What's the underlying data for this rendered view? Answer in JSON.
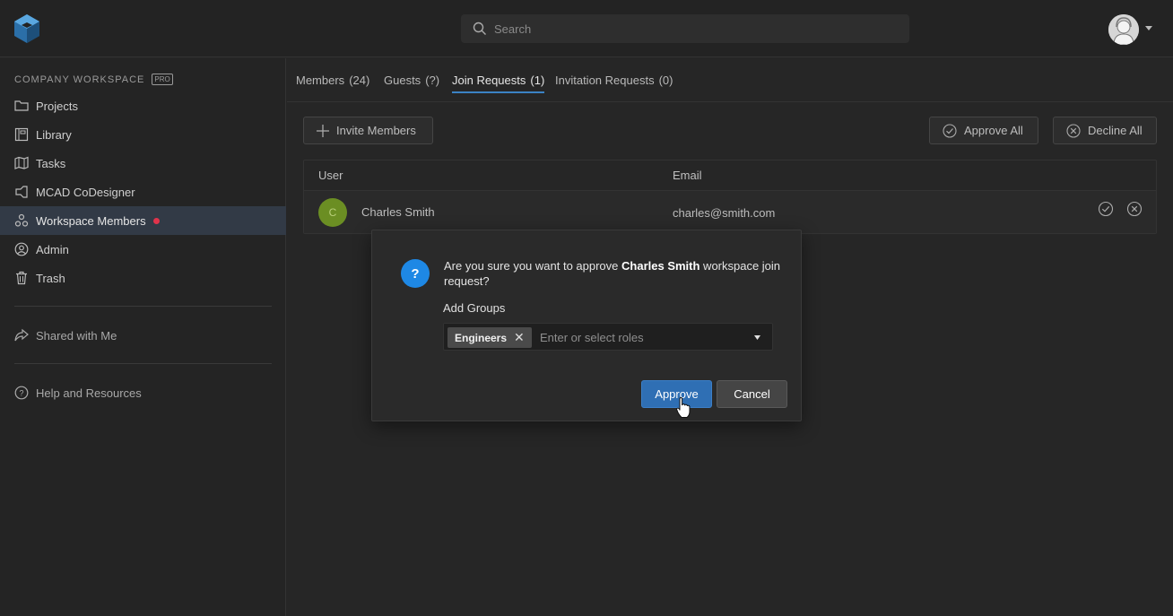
{
  "search": {
    "placeholder": "Search"
  },
  "sidebar": {
    "workspace_label": "COMPANY WORKSPACE",
    "workspace_badge": "PRO",
    "items": [
      {
        "label": "Projects",
        "icon": "folder-icon"
      },
      {
        "label": "Library",
        "icon": "library-icon"
      },
      {
        "label": "Tasks",
        "icon": "tasks-icon"
      },
      {
        "label": "MCAD CoDesigner",
        "icon": "codesigner-icon"
      },
      {
        "label": "Workspace Members",
        "icon": "members-icon",
        "active": true,
        "notification": true
      },
      {
        "label": "Admin",
        "icon": "admin-icon"
      },
      {
        "label": "Trash",
        "icon": "trash-icon"
      }
    ],
    "shared": {
      "label": "Shared with Me",
      "icon": "share-icon"
    },
    "help": {
      "label": "Help and Resources",
      "icon": "help-icon"
    }
  },
  "tabs": [
    {
      "label": "Members",
      "count": "(24)"
    },
    {
      "label": "Guests",
      "count": "(?)"
    },
    {
      "label": "Join Requests",
      "count": "(1)",
      "active": true
    },
    {
      "label": "Invitation Requests",
      "count": "(0)"
    }
  ],
  "toolbar": {
    "invite_label": "Invite Members",
    "approve_all_label": "Approve All",
    "decline_all_label": "Decline All"
  },
  "table": {
    "columns": [
      "User",
      "Email"
    ],
    "rows": [
      {
        "initial": "C",
        "name": "Charles Smith",
        "email": "charles@smith.com"
      }
    ]
  },
  "modal": {
    "message_before": "Are you sure you want to approve ",
    "message_name": "Charles Smith",
    "message_after": " workspace join request?",
    "groups_label": "Add Groups",
    "selected_chip": "Engineers",
    "roles_placeholder": "Enter or select roles",
    "approve_label": "Approve",
    "cancel_label": "Cancel",
    "icon_glyph": "?"
  },
  "colors": {
    "accent": "#1e88e5",
    "approve_button": "#2f6fb4",
    "notification_dot": "#e0334b",
    "active_nav": "#323a46",
    "user_avatar": "#6b8e23"
  }
}
